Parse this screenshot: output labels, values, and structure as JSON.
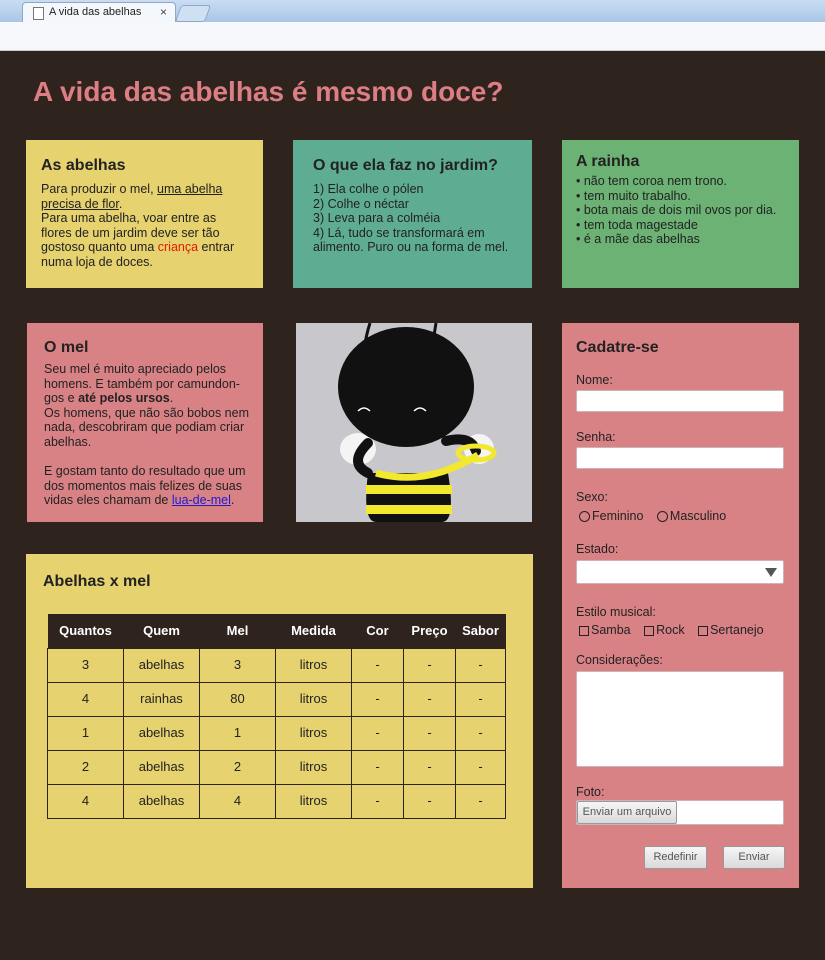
{
  "browser": {
    "tab_title": "A vida das abelhas",
    "tab_close": "×"
  },
  "page": {
    "heading": "A vida das abelhas é mesmo doce?"
  },
  "box_abelhas": {
    "title": "As abelhas",
    "text_1": "Para produzir o mel, ",
    "text_1_link": "uma abelha precisa de flor",
    "text_1_end": ".",
    "text_2": "Para uma abelha, voar entre as flores de um jardim deve ser tão gostoso quanto uma ",
    "text_2_red": "criança",
    "text_2_end": " entrar numa loja de doces."
  },
  "box_jardim": {
    "title": "O que ela faz no jardim?",
    "items": [
      "1) Ela colhe o pólen",
      "2) Colhe o néctar",
      "3) Leva para a colméia",
      "4) Lá, tudo se transformará em alimento. Puro ou na forma de mel."
    ]
  },
  "box_rainha": {
    "title": "A rainha",
    "items": [
      "• não tem coroa nem trono.",
      "• tem muito trabalho.",
      "• bota mais de dois mil ovos por dia.",
      "• tem toda magestade",
      "• é a mãe das abelhas"
    ]
  },
  "box_mel": {
    "title": "O mel",
    "p1_a": "Seu mel é muito apreciado pelos homens. E também por camundon-gos e ",
    "p1_bold": "até pelos ursos",
    "p1_end": ".",
    "p2": "Os homens, que não são bobos nem nada, descobriram que podiam criar abelhas.",
    "p3_a": "E gostam tanto do resultado que um dos momentos mais felizes de suas vidas eles chamam de ",
    "p3_link": "lua-de-mel",
    "p3_end": "."
  },
  "box_tabela": {
    "title": "Abelhas x mel",
    "headers": [
      "Quantos",
      "Quem",
      "Mel",
      "Medida",
      "Cor",
      "Preço",
      "Sabor"
    ],
    "rows": [
      [
        "3",
        "abelhas",
        "3",
        "litros",
        "-",
        "-",
        "-"
      ],
      [
        "4",
        "rainhas",
        "80",
        "litros",
        "-",
        "-",
        "-"
      ],
      [
        "1",
        "abelhas",
        "1",
        "litros",
        "-",
        "-",
        "-"
      ],
      [
        "2",
        "abelhas",
        "2",
        "litros",
        "-",
        "-",
        "-"
      ],
      [
        "4",
        "abelhas",
        "4",
        "litros",
        "-",
        "-",
        "-"
      ]
    ]
  },
  "form": {
    "title": "Cadatre-se",
    "nome_label": "Nome:",
    "senha_label": "Senha:",
    "sexo_label": "Sexo:",
    "sexo_options": [
      "Feminino",
      "Masculino"
    ],
    "estado_label": "Estado:",
    "estilo_label": "Estilo musical:",
    "estilo_options": [
      "Samba",
      "Rock",
      "Sertanejo"
    ],
    "consideracoes_label": "Considerações:",
    "foto_label": "Foto:",
    "upload_button": "Enviar um arquivo",
    "reset_button": "Redefinir",
    "submit_button": "Enviar"
  },
  "colors": {
    "background": "#2e241d",
    "heading": "#dd7d84",
    "yellow": "#e6d26f",
    "teal": "#5ead93",
    "green": "#6cb274",
    "pink": "#d98286"
  }
}
